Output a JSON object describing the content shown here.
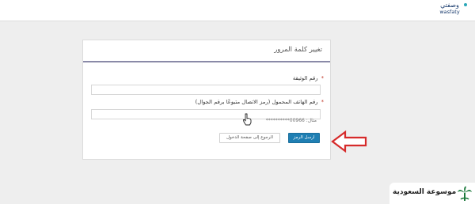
{
  "header": {
    "logo_ar": "وصفتي",
    "logo_en": "wasfaty"
  },
  "form": {
    "title": "تغيير كلمة المرور",
    "document_number": {
      "label": "رقم الوثيقة",
      "required_mark": "*",
      "value": "",
      "placeholder": ""
    },
    "mobile": {
      "label": "رقم الهاتف المحمول (رمز الاتصال متبوعًا برقم الجوال)",
      "required_mark": "*",
      "value": "",
      "placeholder": "مثال: 00966**********"
    },
    "send_code_label": "ارسل الرمز",
    "back_to_login_label": "الرجوع إلى صفحة الدخول"
  },
  "watermark": {
    "text": "موسوعة السعودية"
  },
  "colors": {
    "primary_button": "#1f7fb3",
    "annotation_arrow": "#d62b2b",
    "required_star": "#c0392b",
    "header_underline": "#8a8aa8"
  }
}
